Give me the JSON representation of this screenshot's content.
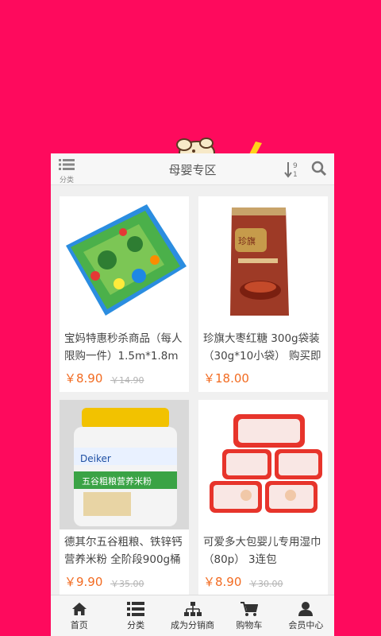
{
  "header": {
    "category_label": "分类",
    "title": "母婴专区",
    "sort_icon": "sort-icon",
    "search_icon": "search-icon"
  },
  "products": [
    {
      "name": "宝妈特惠秒杀商品（每人限购一件）1.5m*1.8m",
      "price": "￥8.90",
      "original_price": "￥14.90",
      "image": "play-mat"
    },
    {
      "name": "珍旗大枣红糖 300g袋装（30g*10小袋） 购买即",
      "price": "￥18.00",
      "original_price": "",
      "image": "brown-sugar-bag"
    },
    {
      "name": "德其尔五谷粗粮、铁锌钙营养米粉 全阶段900g桶",
      "price": "￥9.90",
      "original_price": "￥35.00",
      "image": "rice-cereal-tub"
    },
    {
      "name": "可爱多大包婴儿专用湿巾（80p） 3连包",
      "price": "￥8.90",
      "original_price": "￥30.00",
      "image": "baby-wipes"
    }
  ],
  "tabbar": [
    {
      "label": "首页",
      "icon": "home-icon"
    },
    {
      "label": "分类",
      "icon": "list-icon"
    },
    {
      "label": "成为分销商",
      "icon": "network-icon"
    },
    {
      "label": "购物车",
      "icon": "cart-icon"
    },
    {
      "label": "会员中心",
      "icon": "user-icon"
    }
  ],
  "colors": {
    "background": "#fe0a5d",
    "price": "#f26b21",
    "original_price": "#b3b3b3"
  }
}
